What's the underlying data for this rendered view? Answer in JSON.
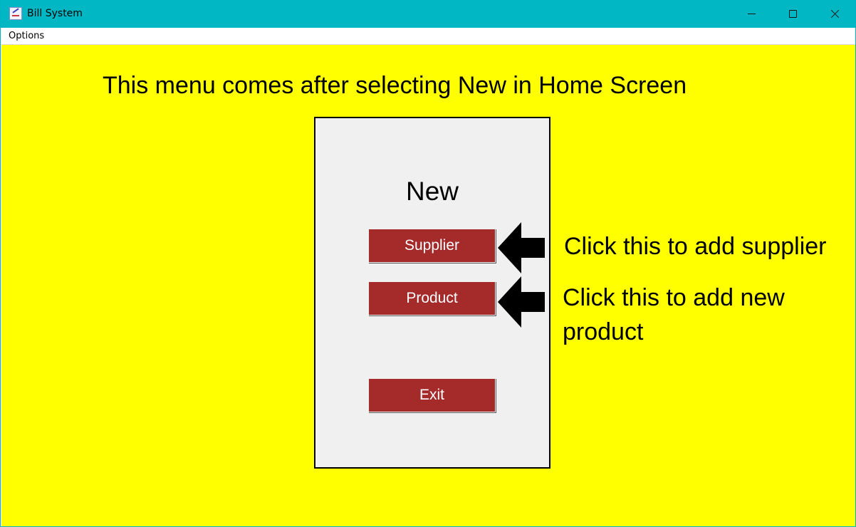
{
  "window": {
    "title": "Bill System"
  },
  "menubar": {
    "options_label": "Options"
  },
  "content": {
    "headline": "This menu comes after selecting New in Home Screen",
    "background_color": "#ffff00",
    "panel": {
      "title": "New",
      "buttons": {
        "supplier_label": "Supplier",
        "product_label": "Product",
        "exit_label": "Exit"
      },
      "button_color": "#a52a2a"
    },
    "annotations": {
      "supplier_note": "Click this to add supplier",
      "product_note": "Click this to add new product"
    }
  },
  "colors": {
    "titlebar": "#00b7c3",
    "panel_background": "#f0f0f0"
  },
  "icons": {
    "app": "bill-system-app-icon",
    "minimize": "minimize-icon",
    "maximize": "maximize-icon",
    "close": "close-icon",
    "annotation_arrow": "left-arrow-icon"
  }
}
